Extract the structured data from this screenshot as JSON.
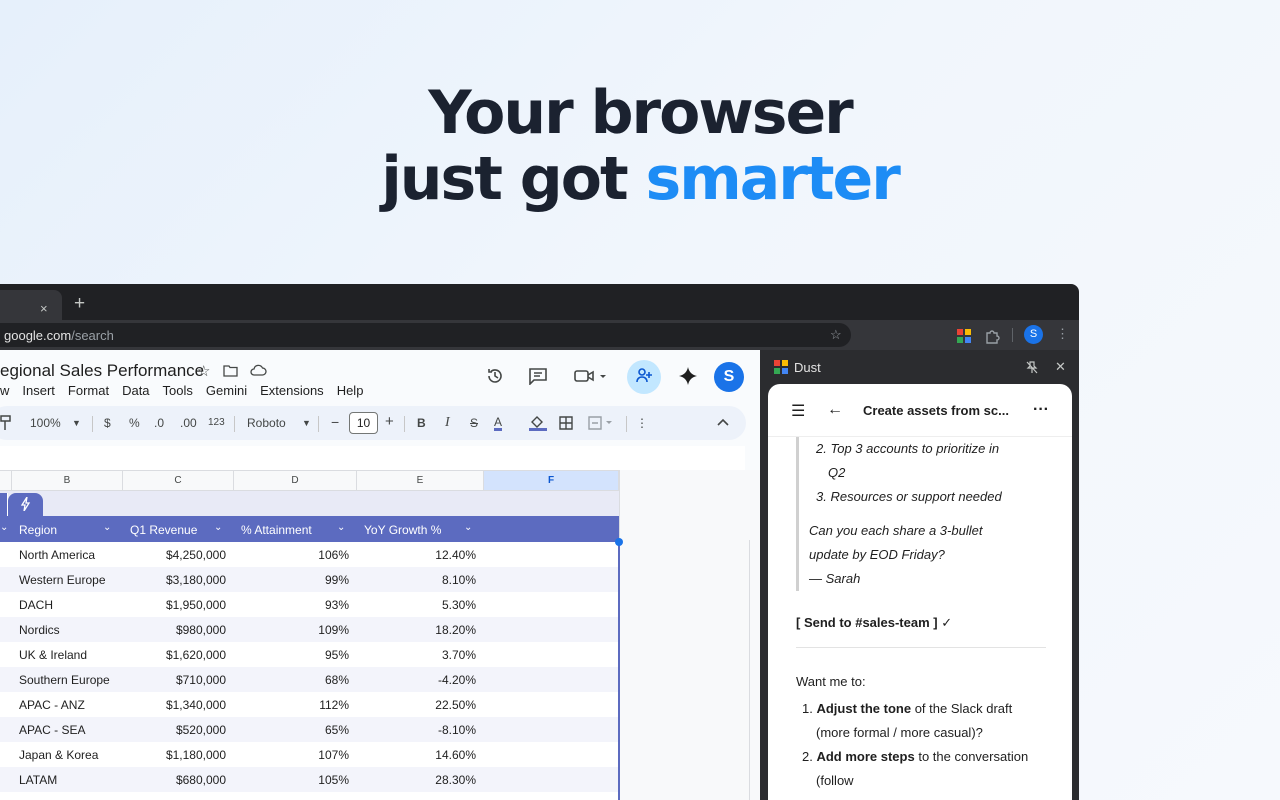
{
  "hero": {
    "line1": "Your browser",
    "line2_start": "just got ",
    "line2_accent": "smarter"
  },
  "browser": {
    "tab_close": "×",
    "new_tab": "+",
    "url_host": "google.com",
    "url_path": "/search",
    "profile_initial": "S"
  },
  "sheets": {
    "title": "egional Sales Performance",
    "menu": [
      "w",
      "Insert",
      "Format",
      "Data",
      "Tools",
      "Gemini",
      "Extensions",
      "Help"
    ],
    "avatar_initial": "S",
    "zoom": "100%",
    "currency": "$",
    "percent": "%",
    "dec_less": ".0",
    "dec_more": ".00",
    "number_fmt": "123",
    "font": "Roboto",
    "font_size": "10",
    "columns": [
      "B",
      "C",
      "D",
      "E",
      "F"
    ],
    "headers": [
      "Region",
      "Q1 Revenue",
      "% Attainment",
      "YoY Growth %"
    ],
    "rows": [
      [
        "North America",
        "$4,250,000",
        "106%",
        "12.40%"
      ],
      [
        "Western Europe",
        "$3,180,000",
        "99%",
        "8.10%"
      ],
      [
        "DACH",
        "$1,950,000",
        "93%",
        "5.30%"
      ],
      [
        "Nordics",
        "$980,000",
        "109%",
        "18.20%"
      ],
      [
        "UK & Ireland",
        "$1,620,000",
        "95%",
        "3.70%"
      ],
      [
        "Southern Europe",
        "$710,000",
        "68%",
        "-4.20%"
      ],
      [
        "APAC - ANZ",
        "$1,340,000",
        "112%",
        "22.50%"
      ],
      [
        "APAC - SEA",
        "$520,000",
        "65%",
        "-8.10%"
      ],
      [
        "Japan & Korea",
        "$1,180,000",
        "107%",
        "14.60%"
      ],
      [
        "LATAM",
        "$680,000",
        "105%",
        "28.30%"
      ]
    ]
  },
  "dust": {
    "app_name": "Dust",
    "conversation_title": "Create assets from sc...",
    "list_item2_num": "2.",
    "list_item2_line1": "Top 3 accounts to prioritize in",
    "list_item2_line2": "Q2",
    "list_item3": "3. Resources or support needed",
    "ask_line1": "Can you each share a 3-bullet",
    "ask_line2": "update by EOD Friday?",
    "signoff": "— Sarah",
    "send_action": "[ Send to #sales-team ]",
    "send_check": " ✓",
    "want_intro": "Want me to:",
    "opt1_num": "1.",
    "opt1_bold": "Adjust the tone",
    "opt1_rest": " of the Slack draft",
    "opt1_line2": "(more formal / more casual)?",
    "opt2_num": "2.",
    "opt2_bold": "Add more steps",
    "opt2_rest": " to the conversation",
    "opt2_line2": "(follow"
  }
}
